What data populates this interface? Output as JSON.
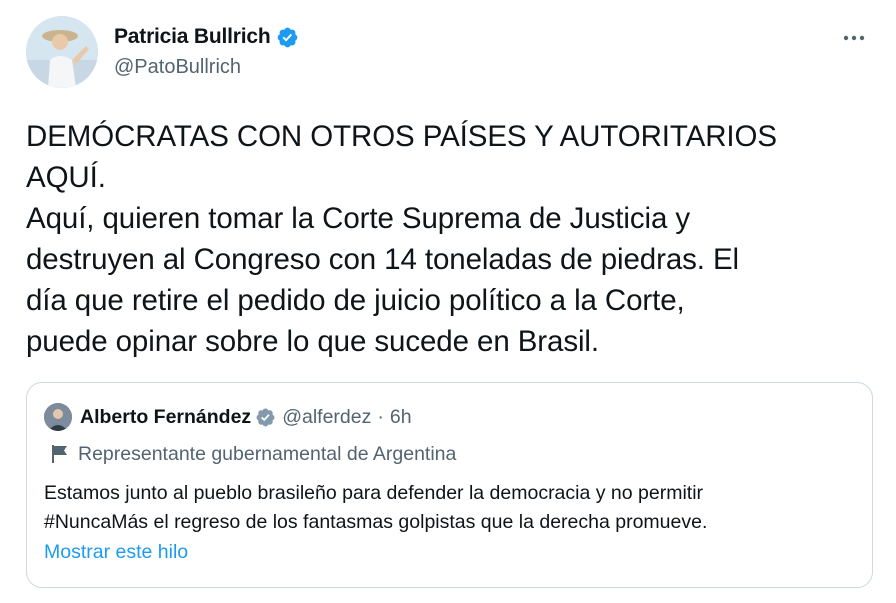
{
  "author": {
    "display_name": "Patricia Bullrich",
    "handle": "@PatoBullrich",
    "verified_icon": "verified-badge-icon",
    "more_icon": "more-options-icon"
  },
  "tweet": {
    "text": "DEMÓCRATAS CON OTROS PAÍSES Y AUTORITARIOS\nAQUÍ.\nAquí, quieren tomar la Corte Suprema de Justicia y\ndestruyen al Congreso con 14 toneladas de piedras. El\ndía que retire el pedido de juicio político a la Corte,\npuede opinar sobre lo que sucede en Brasil."
  },
  "quoted": {
    "display_name": "Alberto Fernández",
    "handle": "@alferdez",
    "separator": "·",
    "time": "6h",
    "label": "Representante gubernamental de Argentina",
    "label_icon": "government-flag-icon",
    "text": "Estamos junto al pueblo brasileño para defender la democracia y no permitir\n#NuncaMás el regreso de los fantasmas golpistas que la derecha promueve.",
    "show_thread_label": "Mostrar este hilo"
  },
  "colors": {
    "verified": "#1d9bf0",
    "link": "#1d9bf0",
    "secondary_text": "#536471",
    "border": "#cfd9de"
  }
}
